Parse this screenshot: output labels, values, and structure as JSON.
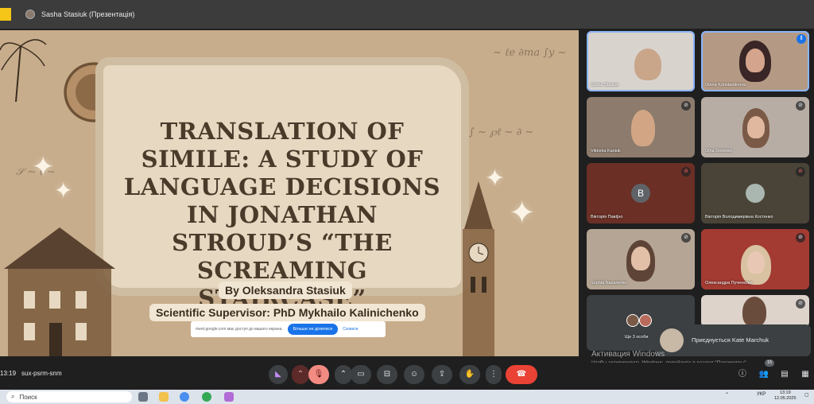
{
  "window": {
    "app_icon": "app-icon",
    "tab_title": "Sasha Stasiuk (Презентація)"
  },
  "slide": {
    "title": "Translation of simile: a study of language decisions in Jonathan Stroud’s “The Screaming Staircase”",
    "author": "By Oleksandra Stasiuk",
    "supervisor": "Scientific Supervisor: PhD Mykhailo Kalinichenko"
  },
  "share_bar": {
    "message": "meet.google.com має доступ до вашого екрана.",
    "stop_button": "Більше не ділитися",
    "hide_link": "Сховати"
  },
  "participants": [
    {
      "name": "Sasha Stasiuk",
      "muted": false
    },
    {
      "name": "Olena Konstantinova",
      "muted": false,
      "speaking": true
    },
    {
      "name": "Viktoriia Kaniuk",
      "muted": true
    },
    {
      "name": "Olha Smishko",
      "muted": true
    },
    {
      "name": "Вікторія Паві[но",
      "muted": true,
      "avatar_letter": "B"
    },
    {
      "name": "Вікторія Володимирівна Костенко",
      "muted": true
    },
    {
      "name": "Sophia Nazarenko",
      "muted": true
    },
    {
      "name": "Олександра Пученкова",
      "muted": true
    },
    {
      "name": "Ще 3 особи",
      "muted": false
    },
    {
      "name": "",
      "muted": true
    }
  ],
  "toast": {
    "text": "Приєднується Kate Marchuk"
  },
  "windows_activation": {
    "title": "Активация Windows",
    "subtitle": "Чтобы активировать Windows, перейдите в раздел \"Параметры\"."
  },
  "meeting_bar": {
    "time": "13:19",
    "code": "sux-psrm-snm",
    "participants_count": "15"
  },
  "taskbar": {
    "search_placeholder": "Поиск",
    "language": "УКР",
    "clock_time": "13:19",
    "clock_date": "12.05.2025"
  },
  "colors": {
    "end_call": "#ea4335",
    "mic_off": "#f28b82",
    "accent": "#1a73e8"
  }
}
